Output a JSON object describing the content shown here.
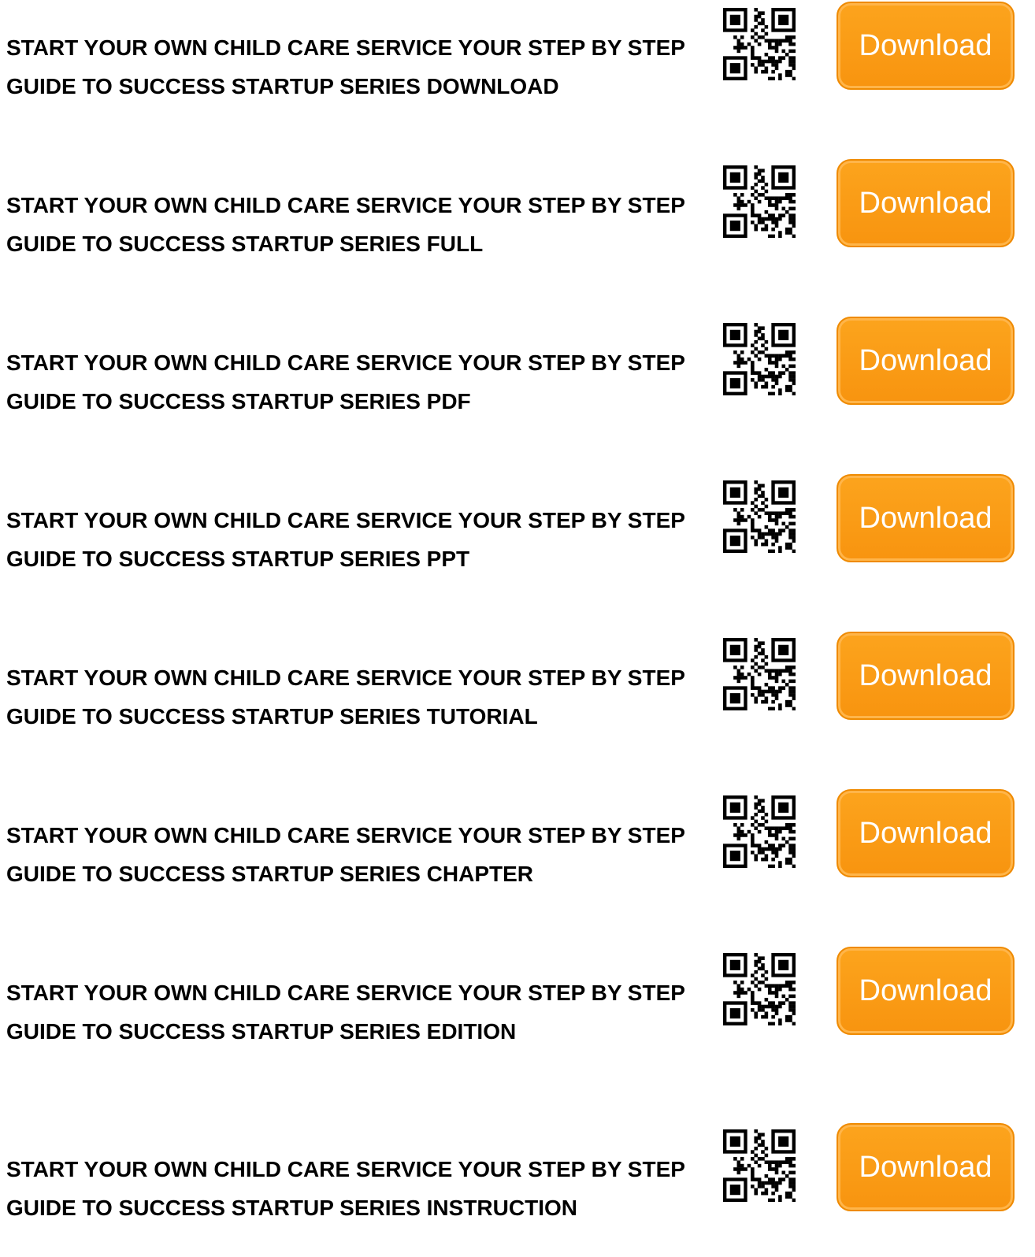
{
  "items": [
    {
      "title": "START YOUR OWN CHILD CARE SERVICE YOUR STEP BY STEP GUIDE TO SUCCESS STARTUP SERIES DOWNLOAD",
      "button_label": "Download"
    },
    {
      "title": "START YOUR OWN CHILD CARE SERVICE YOUR STEP BY STEP GUIDE TO SUCCESS STARTUP SERIES FULL",
      "button_label": "Download"
    },
    {
      "title": "START YOUR OWN CHILD CARE SERVICE YOUR STEP BY STEP GUIDE TO SUCCESS STARTUP SERIES PDF",
      "button_label": "Download"
    },
    {
      "title": "START YOUR OWN CHILD CARE SERVICE YOUR STEP BY STEP GUIDE TO SUCCESS STARTUP SERIES PPT",
      "button_label": "Download"
    },
    {
      "title": "START YOUR OWN CHILD CARE SERVICE YOUR STEP BY STEP GUIDE TO SUCCESS STARTUP SERIES TUTORIAL",
      "button_label": "Download"
    },
    {
      "title": "START YOUR OWN CHILD CARE SERVICE YOUR STEP BY STEP GUIDE TO SUCCESS STARTUP SERIES CHAPTER",
      "button_label": "Download"
    },
    {
      "title": "START YOUR OWN CHILD CARE SERVICE YOUR STEP BY STEP GUIDE TO SUCCESS STARTUP SERIES EDITION",
      "button_label": "Download"
    },
    {
      "title": "START YOUR OWN CHILD CARE SERVICE YOUR STEP BY STEP GUIDE TO SUCCESS STARTUP SERIES INSTRUCTION",
      "button_label": "Download"
    }
  ],
  "icons": {
    "qr": "qr-code-icon"
  },
  "colors": {
    "button": "#f99a14",
    "button_text": "#ffffff",
    "title_text": "#000000"
  }
}
